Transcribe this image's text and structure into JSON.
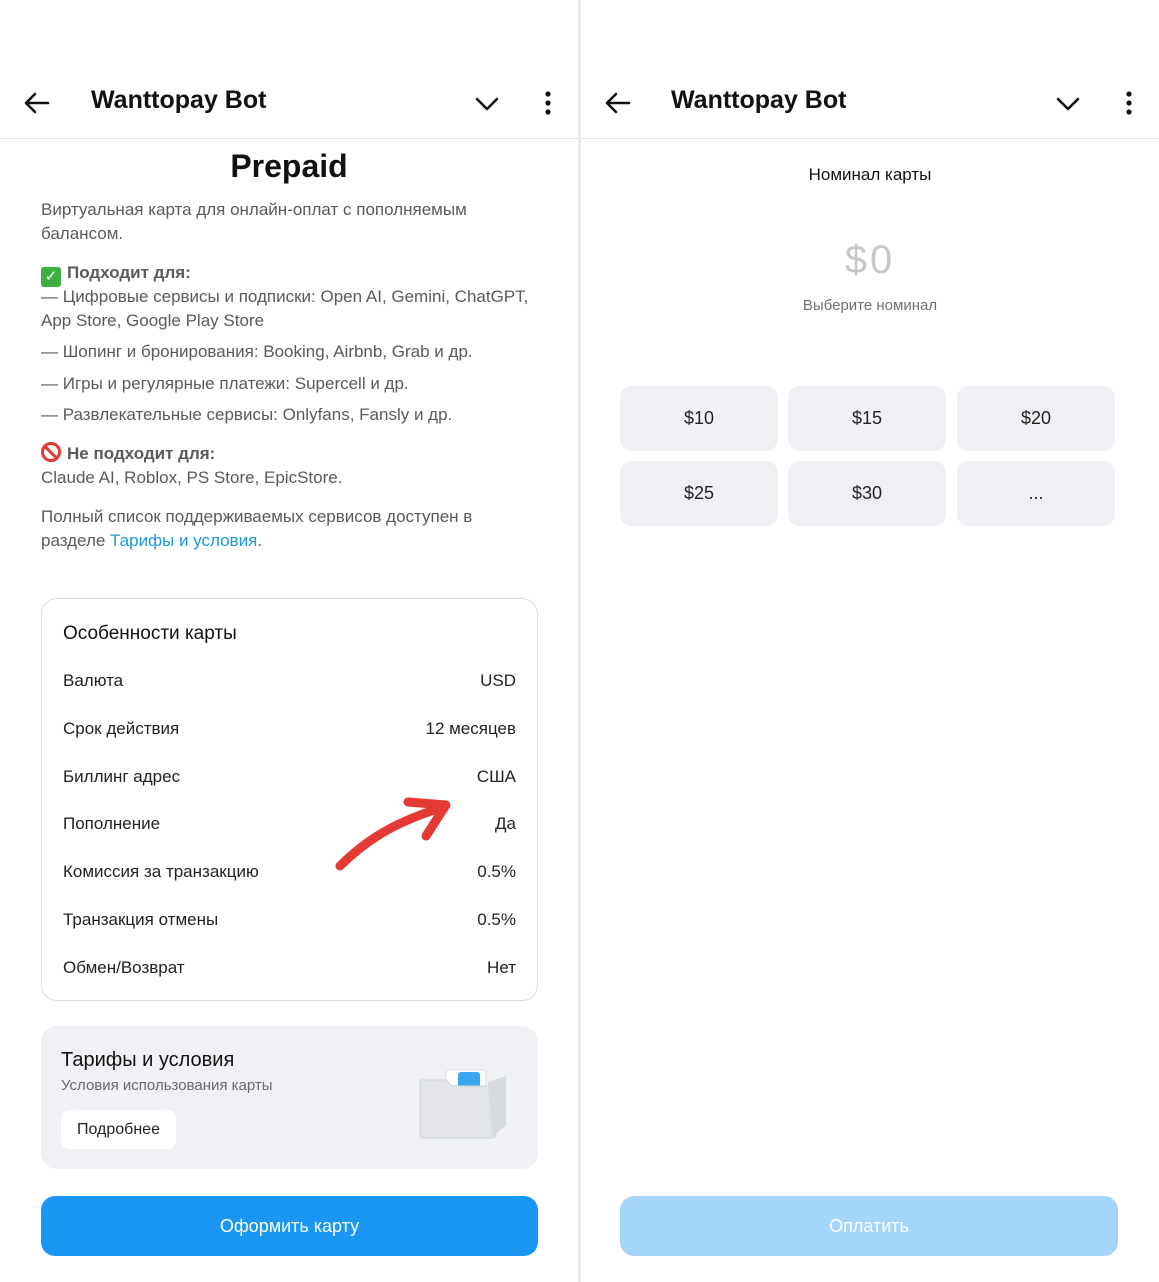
{
  "colors": {
    "accent": "#1a97f2",
    "link": "#1a9ad6",
    "pay_disabled": "#a4d5fa",
    "annotation_arrow": "#e53935"
  },
  "left": {
    "header": {
      "title": "Wanttopay Bot",
      "icons": [
        "arrow-left-icon",
        "chevron-down-icon",
        "more-vertical-icon"
      ]
    },
    "cut_title": "...",
    "title": "Prepaid",
    "description": "Виртуальная карта для онлайн-оплат с пополняемым балансом.",
    "suitable_title": "Подходит для:",
    "suitable_items": [
      "— Цифровые сервисы и подписки: Open AI, Gemini, ChatGPT, App Store, Google Play Store",
      "— Шопинг и бронирования: Booking, Airbnb, Grab и др.",
      "— Игры и регулярные платежи: Supercell и др.",
      "— Развлекательные сервисы: Onlyfans, Fansly и др."
    ],
    "not_suitable_title": "Не подходит для:",
    "not_suitable_text": "Claude AI, Roblox, PS Store, EpicStore.",
    "full_list_prefix": "Полный список поддерживаемых сервисов доступен в разделе ",
    "full_list_link": "Тарифы и условия",
    "full_list_suffix": ".",
    "features": {
      "title": "Особенности карты",
      "rows": [
        {
          "key": "Валюта",
          "value": "USD"
        },
        {
          "key": "Срок действия",
          "value": "12 месяцев"
        },
        {
          "key": "Биллинг адрес",
          "value": "США"
        },
        {
          "key": "Пополнение",
          "value": "Да"
        },
        {
          "key": "Комиссия за транзакцию",
          "value": "0.5%"
        },
        {
          "key": "Транзакция отмены",
          "value": "0.5%"
        },
        {
          "key": "Обмен/Возврат",
          "value": "Нет"
        }
      ]
    },
    "tariff": {
      "title": "Тарифы и условия",
      "subtitle": "Условия использования карты",
      "button": "Подробнее"
    },
    "primary_button": "Оформить карту"
  },
  "right": {
    "header": {
      "title": "Wanttopay Bot"
    },
    "nominal_title": "Номинал карты",
    "amount": "$0",
    "amount_hint": "Выберите номинал",
    "amount_options": [
      "$10",
      "$15",
      "$20",
      "$25",
      "$30",
      "..."
    ],
    "pay_button": "Оплатить"
  }
}
